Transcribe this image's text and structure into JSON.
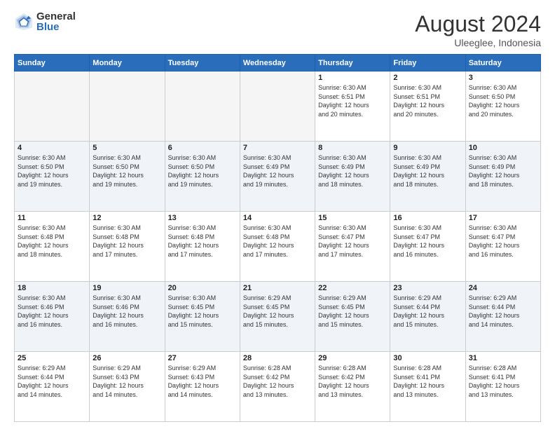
{
  "logo": {
    "general": "General",
    "blue": "Blue"
  },
  "title": "August 2024",
  "location": "Uleeglee, Indonesia",
  "days": [
    "Sunday",
    "Monday",
    "Tuesday",
    "Wednesday",
    "Thursday",
    "Friday",
    "Saturday"
  ],
  "weeks": [
    [
      {
        "day": "",
        "info": ""
      },
      {
        "day": "",
        "info": ""
      },
      {
        "day": "",
        "info": ""
      },
      {
        "day": "",
        "info": ""
      },
      {
        "day": "1",
        "info": "Sunrise: 6:30 AM\nSunset: 6:51 PM\nDaylight: 12 hours\nand 20 minutes."
      },
      {
        "day": "2",
        "info": "Sunrise: 6:30 AM\nSunset: 6:51 PM\nDaylight: 12 hours\nand 20 minutes."
      },
      {
        "day": "3",
        "info": "Sunrise: 6:30 AM\nSunset: 6:50 PM\nDaylight: 12 hours\nand 20 minutes."
      }
    ],
    [
      {
        "day": "4",
        "info": "Sunrise: 6:30 AM\nSunset: 6:50 PM\nDaylight: 12 hours\nand 19 minutes."
      },
      {
        "day": "5",
        "info": "Sunrise: 6:30 AM\nSunset: 6:50 PM\nDaylight: 12 hours\nand 19 minutes."
      },
      {
        "day": "6",
        "info": "Sunrise: 6:30 AM\nSunset: 6:50 PM\nDaylight: 12 hours\nand 19 minutes."
      },
      {
        "day": "7",
        "info": "Sunrise: 6:30 AM\nSunset: 6:49 PM\nDaylight: 12 hours\nand 19 minutes."
      },
      {
        "day": "8",
        "info": "Sunrise: 6:30 AM\nSunset: 6:49 PM\nDaylight: 12 hours\nand 18 minutes."
      },
      {
        "day": "9",
        "info": "Sunrise: 6:30 AM\nSunset: 6:49 PM\nDaylight: 12 hours\nand 18 minutes."
      },
      {
        "day": "10",
        "info": "Sunrise: 6:30 AM\nSunset: 6:49 PM\nDaylight: 12 hours\nand 18 minutes."
      }
    ],
    [
      {
        "day": "11",
        "info": "Sunrise: 6:30 AM\nSunset: 6:48 PM\nDaylight: 12 hours\nand 18 minutes."
      },
      {
        "day": "12",
        "info": "Sunrise: 6:30 AM\nSunset: 6:48 PM\nDaylight: 12 hours\nand 17 minutes."
      },
      {
        "day": "13",
        "info": "Sunrise: 6:30 AM\nSunset: 6:48 PM\nDaylight: 12 hours\nand 17 minutes."
      },
      {
        "day": "14",
        "info": "Sunrise: 6:30 AM\nSunset: 6:48 PM\nDaylight: 12 hours\nand 17 minutes."
      },
      {
        "day": "15",
        "info": "Sunrise: 6:30 AM\nSunset: 6:47 PM\nDaylight: 12 hours\nand 17 minutes."
      },
      {
        "day": "16",
        "info": "Sunrise: 6:30 AM\nSunset: 6:47 PM\nDaylight: 12 hours\nand 16 minutes."
      },
      {
        "day": "17",
        "info": "Sunrise: 6:30 AM\nSunset: 6:47 PM\nDaylight: 12 hours\nand 16 minutes."
      }
    ],
    [
      {
        "day": "18",
        "info": "Sunrise: 6:30 AM\nSunset: 6:46 PM\nDaylight: 12 hours\nand 16 minutes."
      },
      {
        "day": "19",
        "info": "Sunrise: 6:30 AM\nSunset: 6:46 PM\nDaylight: 12 hours\nand 16 minutes."
      },
      {
        "day": "20",
        "info": "Sunrise: 6:30 AM\nSunset: 6:45 PM\nDaylight: 12 hours\nand 15 minutes."
      },
      {
        "day": "21",
        "info": "Sunrise: 6:29 AM\nSunset: 6:45 PM\nDaylight: 12 hours\nand 15 minutes."
      },
      {
        "day": "22",
        "info": "Sunrise: 6:29 AM\nSunset: 6:45 PM\nDaylight: 12 hours\nand 15 minutes."
      },
      {
        "day": "23",
        "info": "Sunrise: 6:29 AM\nSunset: 6:44 PM\nDaylight: 12 hours\nand 15 minutes."
      },
      {
        "day": "24",
        "info": "Sunrise: 6:29 AM\nSunset: 6:44 PM\nDaylight: 12 hours\nand 14 minutes."
      }
    ],
    [
      {
        "day": "25",
        "info": "Sunrise: 6:29 AM\nSunset: 6:44 PM\nDaylight: 12 hours\nand 14 minutes."
      },
      {
        "day": "26",
        "info": "Sunrise: 6:29 AM\nSunset: 6:43 PM\nDaylight: 12 hours\nand 14 minutes."
      },
      {
        "day": "27",
        "info": "Sunrise: 6:29 AM\nSunset: 6:43 PM\nDaylight: 12 hours\nand 14 minutes."
      },
      {
        "day": "28",
        "info": "Sunrise: 6:28 AM\nSunset: 6:42 PM\nDaylight: 12 hours\nand 13 minutes."
      },
      {
        "day": "29",
        "info": "Sunrise: 6:28 AM\nSunset: 6:42 PM\nDaylight: 12 hours\nand 13 minutes."
      },
      {
        "day": "30",
        "info": "Sunrise: 6:28 AM\nSunset: 6:41 PM\nDaylight: 12 hours\nand 13 minutes."
      },
      {
        "day": "31",
        "info": "Sunrise: 6:28 AM\nSunset: 6:41 PM\nDaylight: 12 hours\nand 13 minutes."
      }
    ]
  ]
}
